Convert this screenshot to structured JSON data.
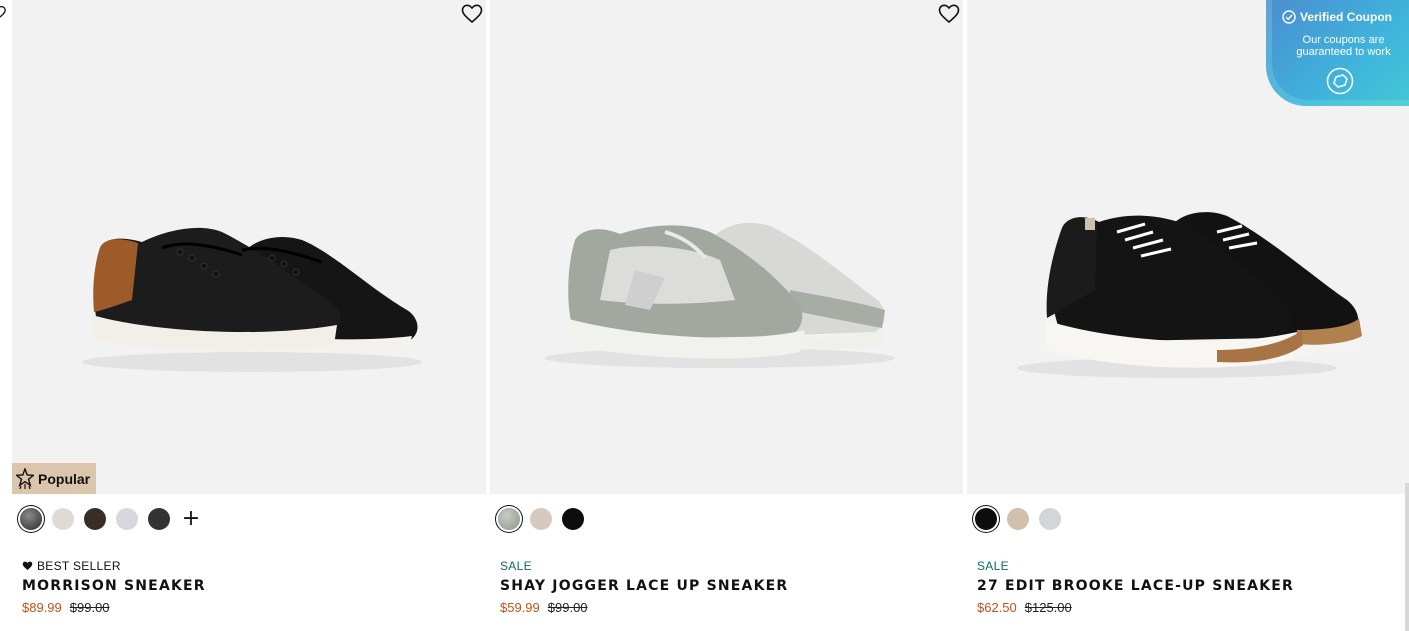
{
  "products": [
    {
      "badge": "BEST SELLER",
      "badge_type": "best",
      "name": "MORRISON SNEAKER",
      "price_now": "$89.99",
      "price_was": "$99.00",
      "popular_label": "Popular",
      "swatches": [
        "#4a4a4a",
        "#dedad6",
        "#3a2d25",
        "#d6d8de",
        "#333333"
      ],
      "more_swatches": "+"
    },
    {
      "badge": "SALE",
      "badge_type": "sale",
      "name": "SHAY JOGGER LACE UP SNEAKER",
      "price_now": "$59.99",
      "price_was": "$99.00",
      "swatches": [
        "#9fa49c",
        "#d7c9bf",
        "#0d0d0d"
      ]
    },
    {
      "badge": "SALE",
      "badge_type": "sale",
      "name": "27 EDIT BROOKE LACE-UP SNEAKER",
      "price_now": "$62.50",
      "price_was": "$125.00",
      "swatches": [
        "#0d0d0d",
        "#d2bfae",
        "#d3d6d8"
      ]
    }
  ],
  "coupon": {
    "title": "Verified Coupon",
    "subtitle": "Our coupons are guaranteed to work"
  },
  "colors": {
    "sale": "#0e6b67",
    "price_now": "#c4501a",
    "popular_bg": "#dcc5ad"
  },
  "icons": [
    "heart-outline-icon",
    "star-icon",
    "heart-filled-icon",
    "check-circle-icon",
    "coupon-logo-icon",
    "plus-icon"
  ]
}
